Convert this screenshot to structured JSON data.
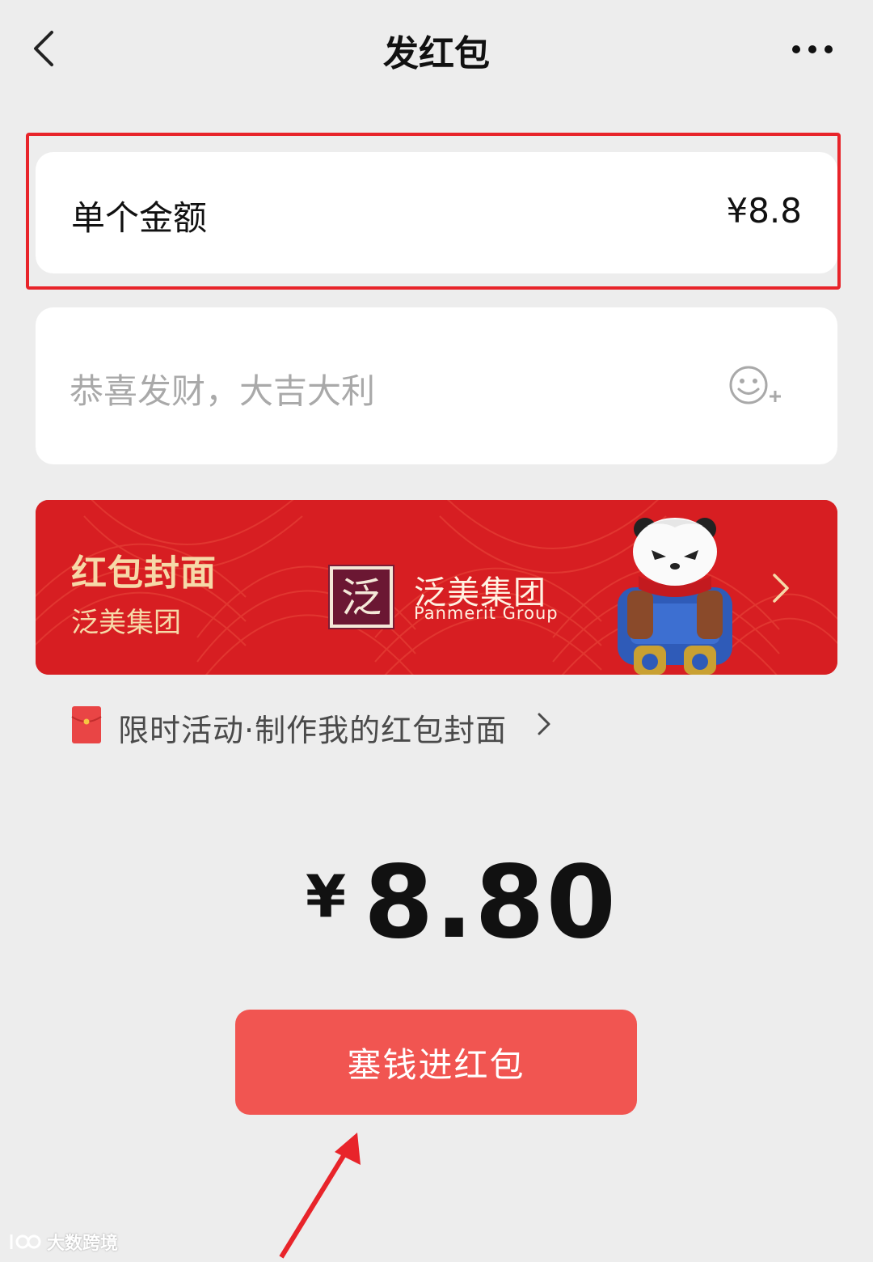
{
  "header": {
    "title": "发红包"
  },
  "amount": {
    "label": "单个金额",
    "value": "¥8.8"
  },
  "greeting": {
    "placeholder": "恭喜发财，大吉大利"
  },
  "cover": {
    "title": "红包封面",
    "subtitle": "泛美集团",
    "brand_cn": "泛美集团",
    "brand_en": "Panmerit Group",
    "logo_char": "泛"
  },
  "activity": {
    "text": "限时活动·制作我的红包封面"
  },
  "total": {
    "currency": "¥",
    "amount": "8.80"
  },
  "submit": {
    "label": "塞钱进红包"
  },
  "watermark": {
    "text": "大数跨境"
  },
  "colors": {
    "page_bg": "#ededed",
    "card_bg": "#ffffff",
    "highlight_border": "#e8242a",
    "cover_red": "#d71e22",
    "cover_gold": "#f6d9a8",
    "button_red": "#f15551",
    "placeholder_gray": "#a9a9a9"
  },
  "icons": {
    "back": "chevron-left-icon",
    "more": "ellipsis-icon",
    "emoji": "emoji-add-icon",
    "cover_next": "chevron-right-icon",
    "activity": "red-envelope-icon",
    "activity_next": "chevron-right-icon"
  }
}
